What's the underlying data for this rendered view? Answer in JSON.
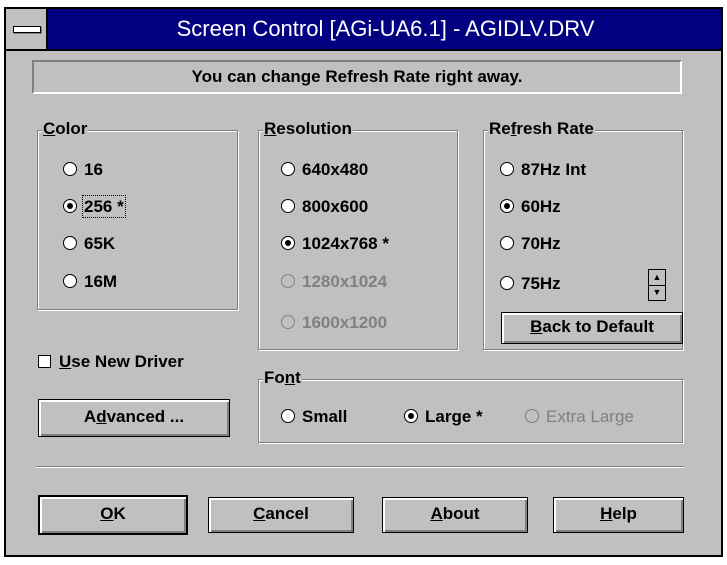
{
  "window": {
    "title": "Screen Control [AGi-UA6.1] - AGIDLV.DRV"
  },
  "status_message": "You can change Refresh Rate right away.",
  "color_group": {
    "legend_u": "C",
    "legend_rest": "olor",
    "options": [
      "16",
      "256 *",
      "65K",
      "16M"
    ],
    "selected": "256 *"
  },
  "resolution_group": {
    "legend_u": "R",
    "legend_rest": "esolution",
    "options": [
      "640x480",
      "800x600",
      "1024x768 *",
      "1280x1024",
      "1600x1200"
    ],
    "selected": "1024x768 *",
    "disabled": [
      "1280x1024",
      "1600x1200"
    ]
  },
  "refresh_group": {
    "legend_pre": "Re",
    "legend_u": "f",
    "legend_rest": "resh Rate",
    "options": [
      "87Hz Int",
      "60Hz",
      "70Hz",
      "75Hz"
    ],
    "selected": "60Hz",
    "spinner": {
      "up": "▲",
      "down": "▼"
    },
    "back_default_u": "B",
    "back_default_rest": "ack to Default"
  },
  "use_new_driver": {
    "u": "U",
    "rest": "se New Driver",
    "checked": false
  },
  "advanced_button": {
    "pre": "A",
    "u": "d",
    "rest": "vanced ..."
  },
  "font_group": {
    "legend_pre": "Fo",
    "legend_u": "n",
    "legend_rest": "t",
    "options": [
      "Small",
      "Large *",
      "Extra Large"
    ],
    "selected": "Large *",
    "disabled": [
      "Extra Large"
    ]
  },
  "buttons": {
    "ok_u": "O",
    "ok_rest": "K",
    "cancel_u": "C",
    "cancel_rest": "ancel",
    "about_u": "A",
    "about_rest": "bout",
    "help_u": "H",
    "help_rest": "elp"
  }
}
